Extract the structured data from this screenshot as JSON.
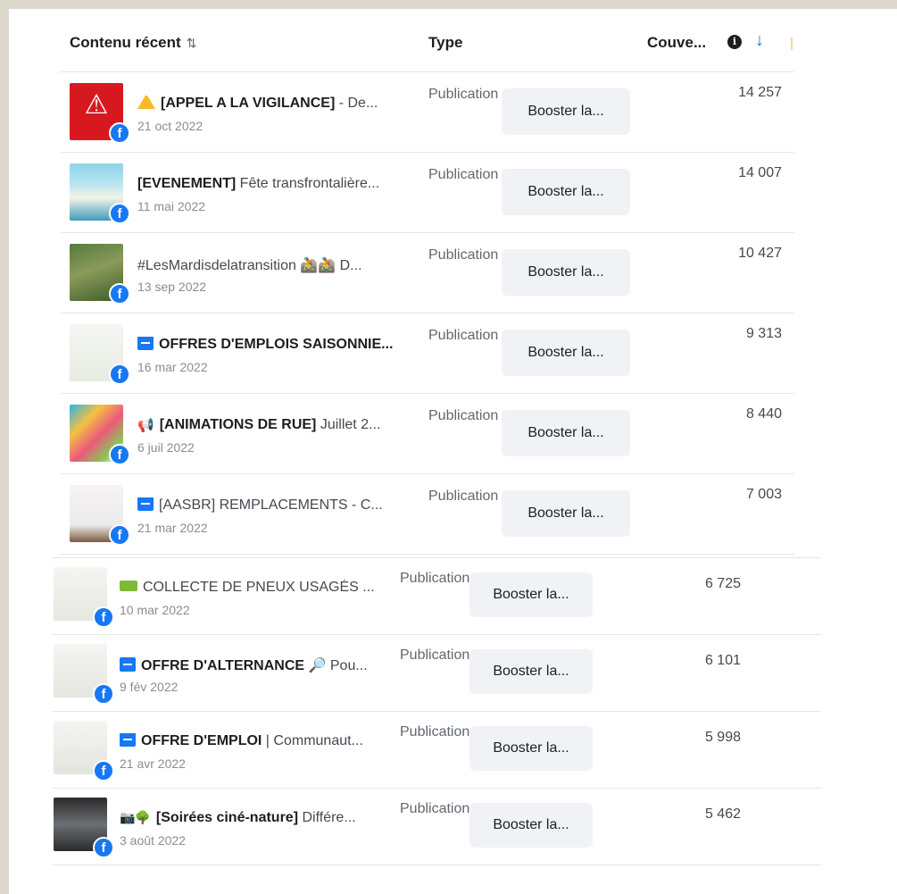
{
  "header": {
    "content_label": "Contenu récent",
    "sort_glyph": "⇅",
    "type_label": "Type",
    "reach_label": "Couve...",
    "info_glyph": "i",
    "sort_desc_glyph": "↓"
  },
  "colors": {
    "facebook_blue": "#1877f2",
    "button_bg": "#f0f2f5",
    "divider": "#e4e6eb",
    "backdrop": "#ddd9cc"
  },
  "fb_glyph": "f",
  "rows": [
    {
      "title_bold": "[APPEL A LA VIGILANCE]",
      "title_rest": " - De...",
      "prefix_icon": "warning-icon",
      "date": "21 oct 2022",
      "type": "Publication",
      "boost_label": "Booster la...",
      "reach": "14 257",
      "thumb_label": "⚠"
    },
    {
      "title_bold": "[EVENEMENT]",
      "title_rest": " Fête transfrontalière...",
      "prefix_icon": "",
      "date": "11 mai 2022",
      "type": "Publication",
      "boost_label": "Booster la...",
      "reach": "14 007"
    },
    {
      "title_bold": "",
      "title_rest": "#LesMardisdelatransition 🚵🚵 D...",
      "prefix_icon": "",
      "date": "13 sep 2022",
      "type": "Publication",
      "boost_label": "Booster la...",
      "reach": "10 427"
    },
    {
      "title_bold": "OFFRES D'EMPLOIS SAISONNIE...",
      "title_rest": "",
      "prefix_icon": "blue-square-icon",
      "date": "16 mar 2022",
      "type": "Publication",
      "boost_label": "Booster la...",
      "reach": "9 313"
    },
    {
      "title_bold": "[ANIMATIONS DE RUE]",
      "title_rest": " Juillet 2...",
      "prefix_icon": "megaphone-icon",
      "date": "6 juil 2022",
      "type": "Publication",
      "boost_label": "Booster la...",
      "reach": "8 440"
    },
    {
      "title_bold": "",
      "title_rest": "[AASBR] REMPLACEMENTS - C...",
      "prefix_icon": "blue-square-icon",
      "date": "21 mar 2022",
      "type": "Publication",
      "boost_label": "Booster la...",
      "reach": "7 003"
    },
    {
      "title_bold": "",
      "title_rest": "COLLECTE DE PNEUX USAGÉS ...",
      "prefix_icon": "truck-icon",
      "date": "10 mar 2022",
      "type": "Publication",
      "boost_label": "Booster la...",
      "reach": "6 725"
    },
    {
      "title_bold": "OFFRE D'ALTERNANCE",
      "title_rest": " 🔎 Pou...",
      "prefix_icon": "blue-square-icon",
      "date": "9 fév 2022",
      "type": "Publication",
      "boost_label": "Booster la...",
      "reach": "6 101"
    },
    {
      "title_bold": "OFFRE D'EMPLOI",
      "title_rest": " | Communaut...",
      "prefix_icon": "blue-square-icon",
      "date": "21 avr 2022",
      "type": "Publication",
      "boost_label": "Booster la...",
      "reach": "5 998"
    },
    {
      "title_bold": "[Soirées ciné-nature]",
      "title_rest": " Différe...",
      "prefix_icon": "camera-tree-icon",
      "date": "3 août 2022",
      "type": "Publication",
      "boost_label": "Booster la...",
      "reach": "5 462"
    }
  ]
}
